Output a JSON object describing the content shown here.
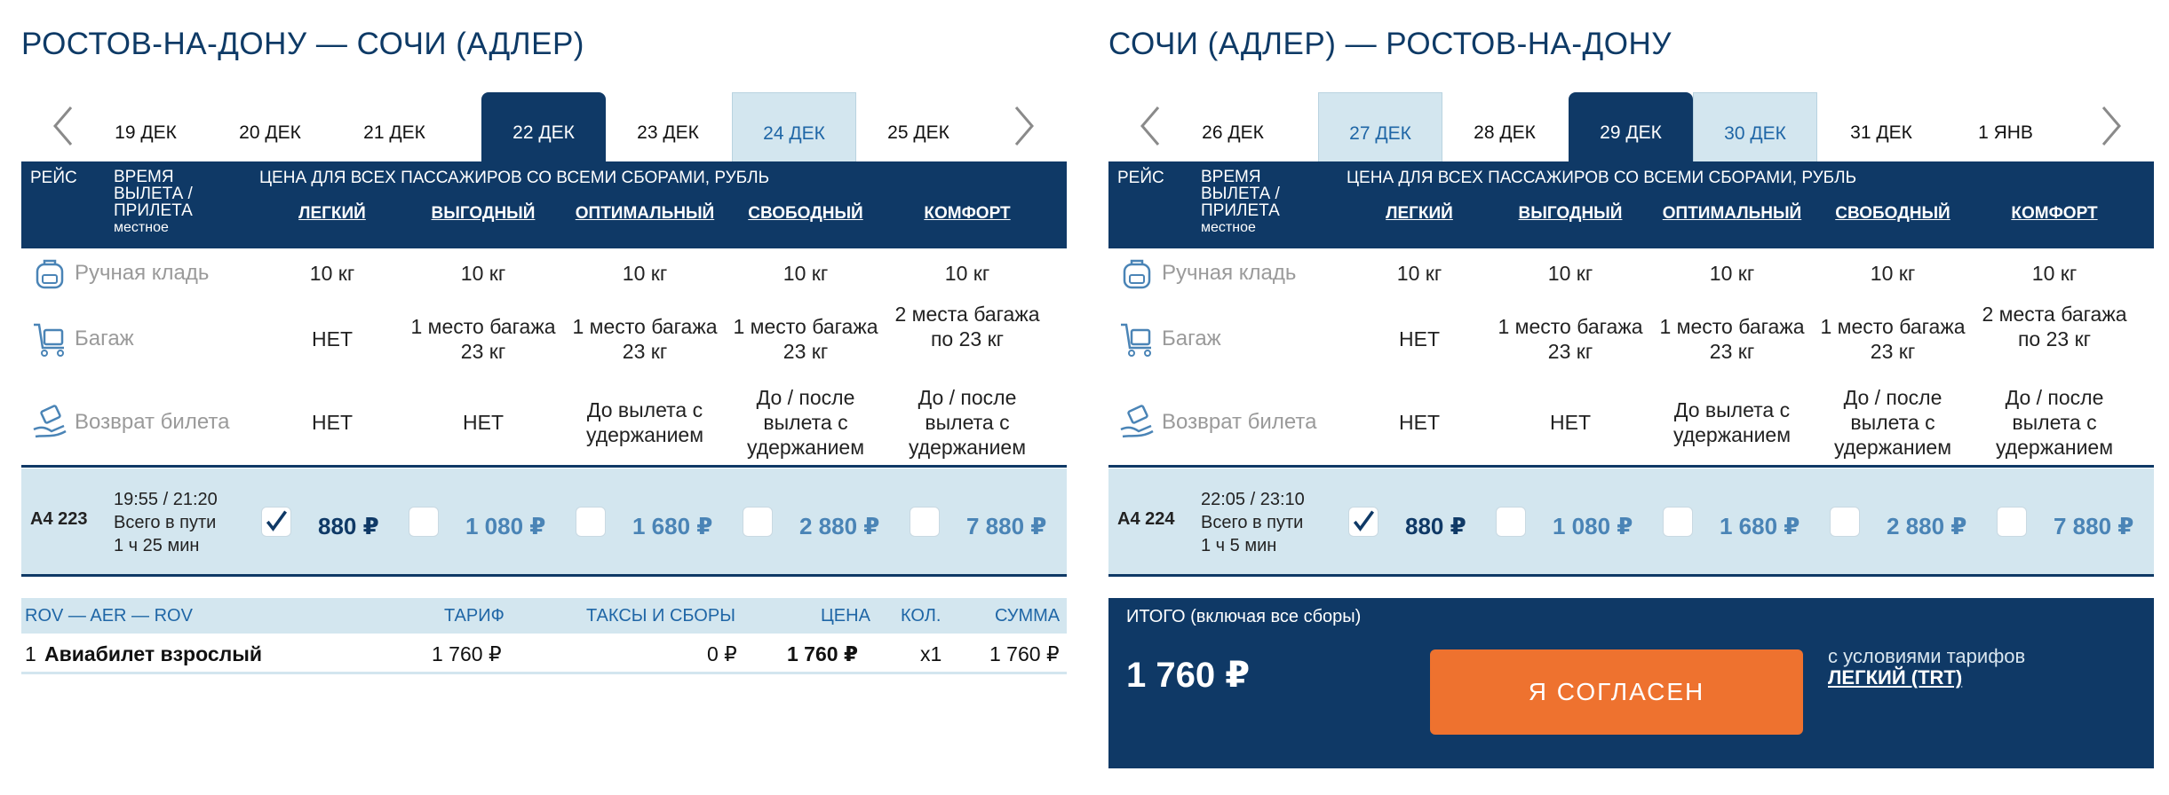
{
  "left": {
    "title": "РОСТОВ-НА-ДОНУ — СОЧИ (АДЛЕР)",
    "dates": [
      {
        "label": "19 ДЕК",
        "state": "normal"
      },
      {
        "label": "20 ДЕК",
        "state": "normal"
      },
      {
        "label": "21 ДЕК",
        "state": "normal"
      },
      {
        "label": "22 ДЕК",
        "state": "active"
      },
      {
        "label": "23 ДЕК",
        "state": "normal"
      },
      {
        "label": "24 ДЕК",
        "state": "light"
      },
      {
        "label": "25 ДЕК",
        "state": "normal"
      }
    ],
    "flight": {
      "number": "А4 223",
      "times": "19:55 / 21:20",
      "duration_label": "Всего в пути",
      "duration": "1 ч 25 мин",
      "prices": [
        "880 ₽",
        "1 080 ₽",
        "1 680 ₽",
        "2 880 ₽",
        "7 880 ₽"
      ],
      "selected_index": 0
    },
    "breakdown": {
      "route": "ROV — AER — ROV",
      "col_tariff": "ТАРИФ",
      "col_taxes": "ТАКСЫ И СБОРЫ",
      "col_price": "ЦЕНА",
      "col_qty": "КОЛ.",
      "col_sum": "СУММА",
      "row": {
        "index": "1",
        "name": "Авиабилет взрослый",
        "tariff": "1 760 ₽",
        "taxes": "0 ₽",
        "price": "1 760 ₽",
        "qty": "х1",
        "sum": "1 760 ₽"
      }
    }
  },
  "right": {
    "title": "СОЧИ (АДЛЕР) — РОСТОВ-НА-ДОНУ",
    "dates": [
      {
        "label": "26 ДЕК",
        "state": "normal"
      },
      {
        "label": "27 ДЕК",
        "state": "light"
      },
      {
        "label": "28 ДЕК",
        "state": "normal"
      },
      {
        "label": "29 ДЕК",
        "state": "active"
      },
      {
        "label": "30 ДЕК",
        "state": "light"
      },
      {
        "label": "31 ДЕК",
        "state": "normal"
      },
      {
        "label": "1 ЯНВ",
        "state": "normal"
      }
    ],
    "flight": {
      "number": "А4 224",
      "times": "22:05 / 23:10",
      "duration_label": "Всего в пути",
      "duration": "1 ч 5 мин",
      "prices": [
        "880 ₽",
        "1 080 ₽",
        "1 680 ₽",
        "2 880 ₽",
        "7 880 ₽"
      ],
      "selected_index": 0
    },
    "total": {
      "label": "ИТОГО (включая все сборы)",
      "amount": "1 760 ₽",
      "agree_button": "Я СОГЛАСЕН",
      "conditions_text": "с условиями тарифов",
      "conditions_link": "ЛЕГКИЙ (TRT)"
    }
  },
  "header": {
    "flight": "РЕЙС",
    "time_line1": "ВРЕМЯ",
    "time_line2": "ВЫЛЕТА /",
    "time_line3": "ПРИЛЕТА",
    "time_sub": "местное",
    "price_caption": "ЦЕНА ДЛЯ ВСЕХ ПАССАЖИРОВ СО ВСЕМИ СБОРАМИ, РУБЛЬ",
    "fares": [
      "ЛЕГКИЙ",
      "ВЫГОДНЫЙ",
      "ОПТИМАЛЬНЫЙ",
      "СВОБОДНЫЙ",
      "КОМФОРТ"
    ]
  },
  "features": {
    "hand_baggage": {
      "label": "Ручная кладь",
      "icon": "backpack-icon",
      "values": [
        "10 кг",
        "10 кг",
        "10 кг",
        "10 кг",
        "10 кг"
      ]
    },
    "baggage": {
      "label": "Багаж",
      "icon": "luggage-cart-icon",
      "values": [
        "НЕТ",
        "1 место багажа 23 кг",
        "1 место багажа 23 кг",
        "1 место багажа 23 кг",
        "2 места багажа по 23 кг"
      ]
    },
    "refund": {
      "label": "Возврат билета",
      "icon": "refund-hand-icon",
      "values": [
        "НЕТ",
        "НЕТ",
        "До вылета с удержанием",
        "До / после вылета с удержанием",
        "До / после вылета с удержанием"
      ]
    }
  },
  "colors": {
    "navy": "#0f3966",
    "light_blue": "#d3e6ef",
    "price_blue": "#4a84b6",
    "orange": "#ee722f"
  }
}
